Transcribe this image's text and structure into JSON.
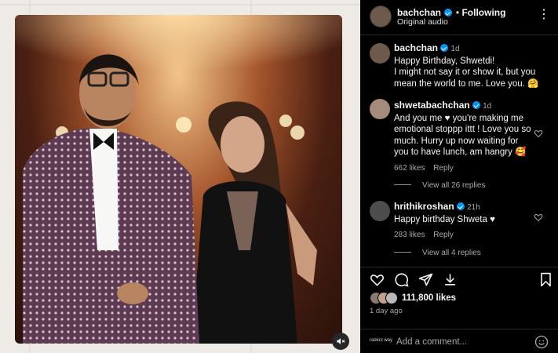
{
  "header": {
    "username": "bachchan",
    "follow_label": "Following",
    "audio": "Original audio",
    "more": "⋮"
  },
  "caption": {
    "username": "bachchan",
    "time": "1d",
    "line1": "Happy Birthday, Shwetdi!",
    "line2": "I might not say it or show it, but you",
    "line3": "mean the world to me. Love you. 🤗"
  },
  "comments": [
    {
      "username": "shwetabachchan",
      "time": "1d",
      "lines": [
        "And you me ♥ you're making me",
        "emotional stoppp ittt ! Love you so",
        "much. Hurry up now waiting for",
        "you to have lunch, am hangry 🥰"
      ],
      "likes": "662 likes",
      "reply": "Reply",
      "view_replies": "View all 26 replies"
    },
    {
      "username": "hrithikroshan",
      "time": "21h",
      "lines": [
        "Happy birthday Shweta ♥"
      ],
      "likes": "283 likes",
      "reply": "Reply",
      "view_replies": "View all 4 replies"
    }
  ],
  "likes_count": "111,800 likes",
  "posted": "1 day ago",
  "comment_placeholder": "Add a comment...",
  "watermark": "radio3 way"
}
